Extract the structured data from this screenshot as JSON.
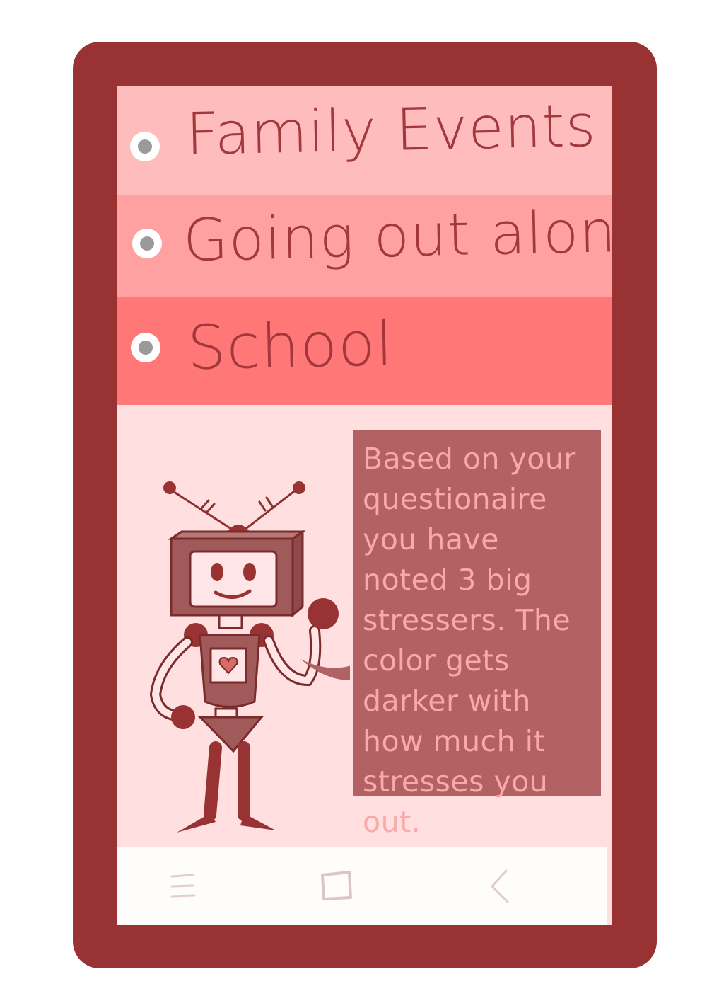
{
  "options": [
    {
      "label": "Family Events",
      "color": "#ffbcbc"
    },
    {
      "label": "Going out alone",
      "color": "#ffa1a1"
    },
    {
      "label": "School",
      "color": "#ff7777"
    }
  ],
  "assistant": {
    "message": "Based on your questionaire you have noted 3 big stressers. The color gets darker with how much it stresses you out."
  },
  "navbar": {
    "icons": [
      "menu-lines-icon",
      "home-square-icon",
      "back-chevron-icon"
    ]
  },
  "colors": {
    "phone_frame": "#993333",
    "screen_background": "#ffdfdf",
    "label_text": "#a2383c",
    "bubble_background": "#b26262",
    "bubble_text": "#f9a9a9"
  }
}
